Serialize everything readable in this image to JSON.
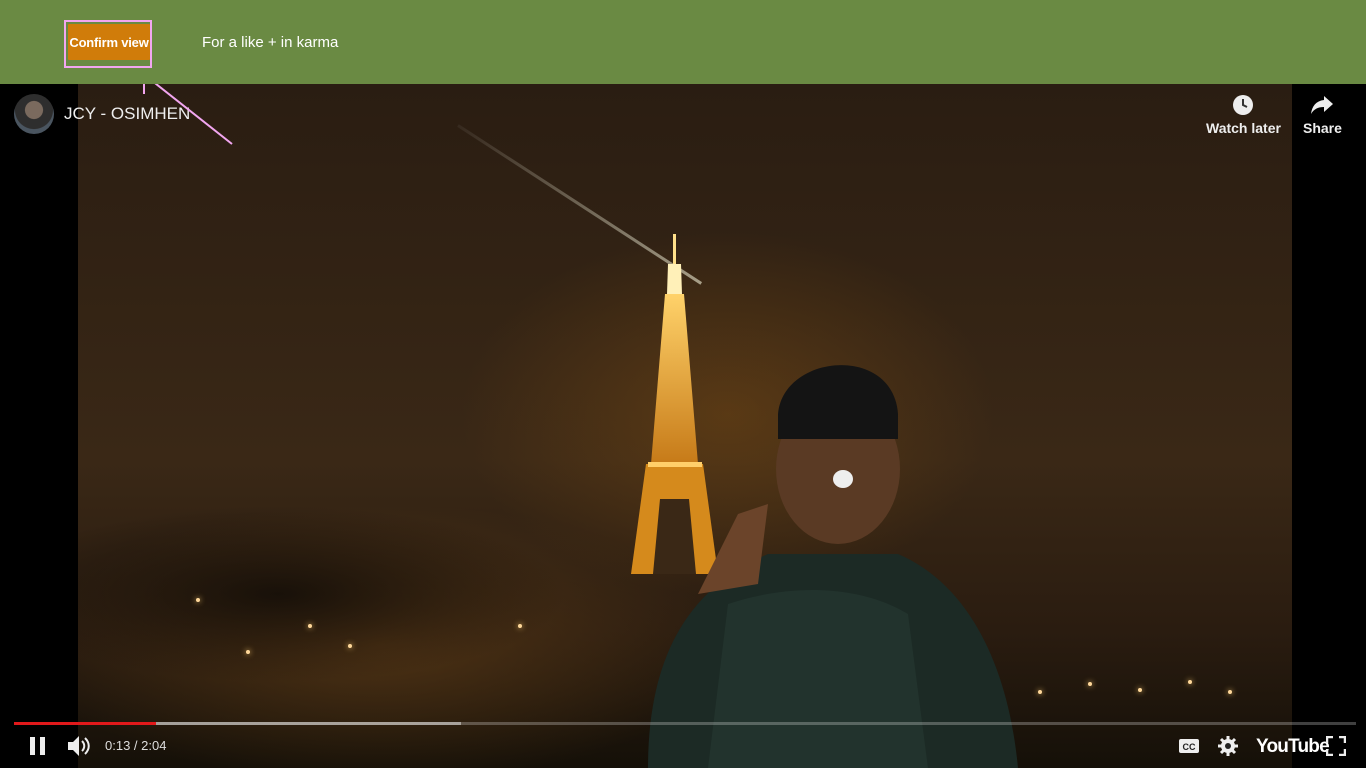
{
  "banner": {
    "confirm_label": "Confirm view",
    "karma_text": "For a like + in karma"
  },
  "video": {
    "title": "JCY - OSIMHEN",
    "watch_later_label": "Watch later",
    "share_label": "Share",
    "time_display": "0:13 / 2:04",
    "played_fraction": 0.106,
    "buffered_fraction": 0.333,
    "youtube_logo": "YouTube"
  },
  "colors": {
    "banner_bg": "#6a8a43",
    "confirm_bg": "#d07c0a",
    "annotation": "#f2a6f0",
    "progress_played": "#e1191b"
  },
  "icons": [
    "clock-icon",
    "share-arrow-icon",
    "pause-icon",
    "volume-icon",
    "cc-icon",
    "gear-icon",
    "fullscreen-icon"
  ]
}
